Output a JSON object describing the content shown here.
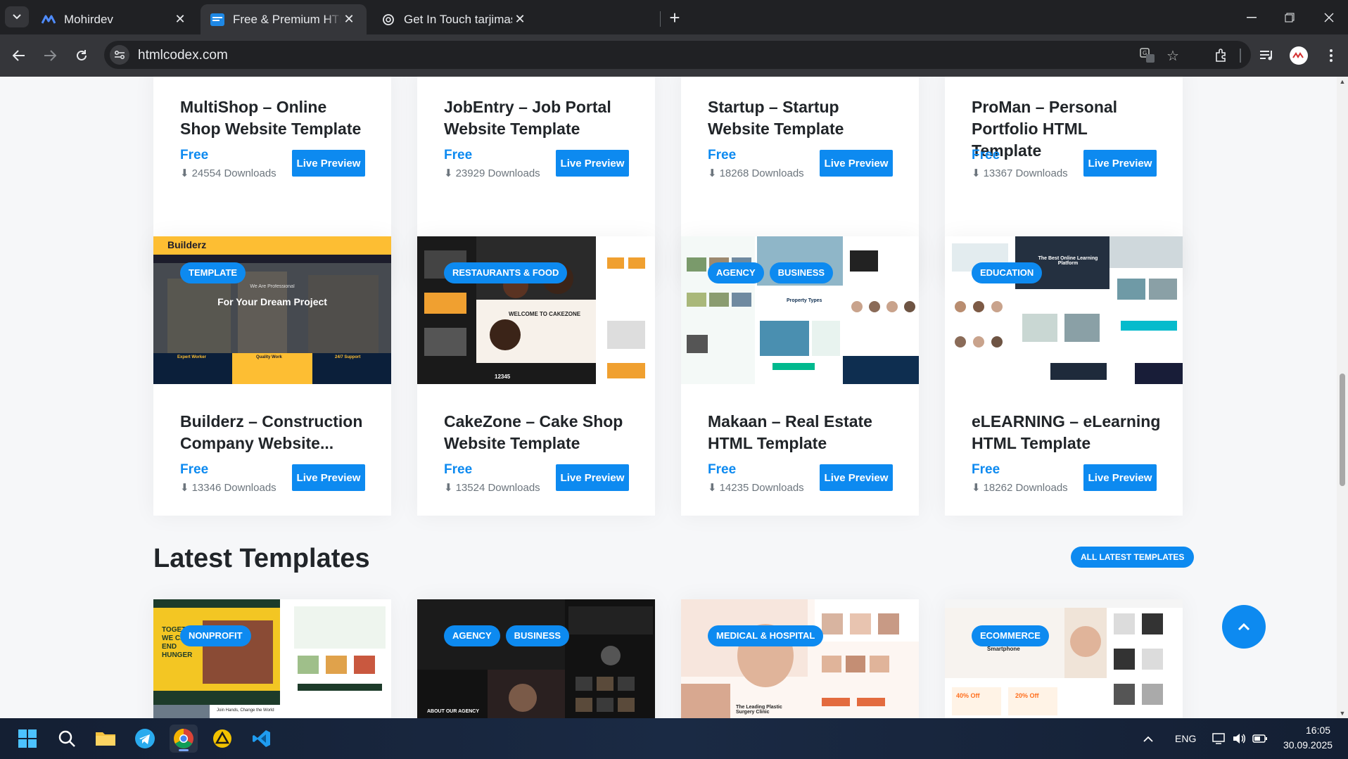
{
  "browser": {
    "tabs": [
      {
        "title": "Mohirdev",
        "favicon": "mohirdev-logo-icon"
      },
      {
        "title": "Free & Premium HTML Website",
        "favicon": "htmlcodex-logo-icon"
      },
      {
        "title": "Get In Touch tarjimasi",
        "favicon": "chatgpt-logo-icon"
      }
    ],
    "url": "htmlcodex.com"
  },
  "cards_row1": [
    {
      "title": "MultiShop – Online Shop Website Template",
      "price": "Free",
      "downloads": "24554 Downloads",
      "button": "Live Preview"
    },
    {
      "title": "JobEntry – Job Portal Website Template",
      "price": "Free",
      "downloads": "23929 Downloads",
      "button": "Live Preview"
    },
    {
      "title": "Startup – Startup Website Template",
      "price": "Free",
      "downloads": "18268 Downloads",
      "button": "Live Preview"
    },
    {
      "title": "ProMan – Personal Portfolio HTML Template",
      "price": "Free",
      "downloads": "13367 Downloads",
      "button": "Live Preview"
    }
  ],
  "cards_row2": [
    {
      "tags": [
        "TEMPLATE"
      ],
      "title": "Builderz – Construction Company Website...",
      "price": "Free",
      "downloads": "13346 Downloads",
      "button": "Live Preview",
      "thumb_text": {
        "brand": "Builderz",
        "headline": "For Your Dream Project",
        "sub": "We Are Professional",
        "f1": "Expert Worker",
        "f2": "Quality Work",
        "f3": "24/7 Support"
      }
    },
    {
      "tags": [
        "RESTAURANTS & FOOD"
      ],
      "title": "CakeZone – Cake Shop Website Template",
      "price": "Free",
      "downloads": "13524 Downloads",
      "button": "Live Preview",
      "thumb_text": {
        "headline": "WELCOME TO CAKEZONE",
        "stat": "12345"
      }
    },
    {
      "tags": [
        "AGENCY",
        "BUSINESS"
      ],
      "title": "Makaan – Real Estate HTML Template",
      "price": "Free",
      "downloads": "14235 Downloads",
      "button": "Live Preview",
      "thumb_text": {
        "headline": "Property Types"
      }
    },
    {
      "tags": [
        "EDUCATION"
      ],
      "title": "eLEARNING – eLearning HTML Template",
      "price": "Free",
      "downloads": "18262 Downloads",
      "button": "Live Preview",
      "thumb_text": {
        "headline": "The Best Online Learning Platform"
      }
    }
  ],
  "latest": {
    "heading": "Latest Templates",
    "all_button": "ALL LATEST TEMPLATES",
    "cards": [
      {
        "tags": [
          "NONPROFIT"
        ],
        "thumb_text": {
          "headline": "TOGETHER WE CAN END HUNGER",
          "sub": "Join Hands, Change the World"
        }
      },
      {
        "tags": [
          "AGENCY",
          "BUSINESS"
        ],
        "thumb_text": {
          "headline": "ABOUT OUR AGENCY"
        }
      },
      {
        "tags": [
          "MEDICAL & HOSPITAL"
        ],
        "thumb_text": {
          "headline": "The Leading Plastic Surgery Clinic"
        }
      },
      {
        "tags": [
          "ECOMMERCE"
        ],
        "thumb_text": {
          "headline": "Smartphone",
          "off1": "40% Off",
          "off2": "20% Off"
        }
      }
    ]
  },
  "taskbar": {
    "language": "ENG",
    "time": "16:05",
    "date": "30.09.2025"
  },
  "colors": {
    "accent": "#0d8af0",
    "chrome_dark": "#202124",
    "chrome_mid": "#35363a"
  }
}
